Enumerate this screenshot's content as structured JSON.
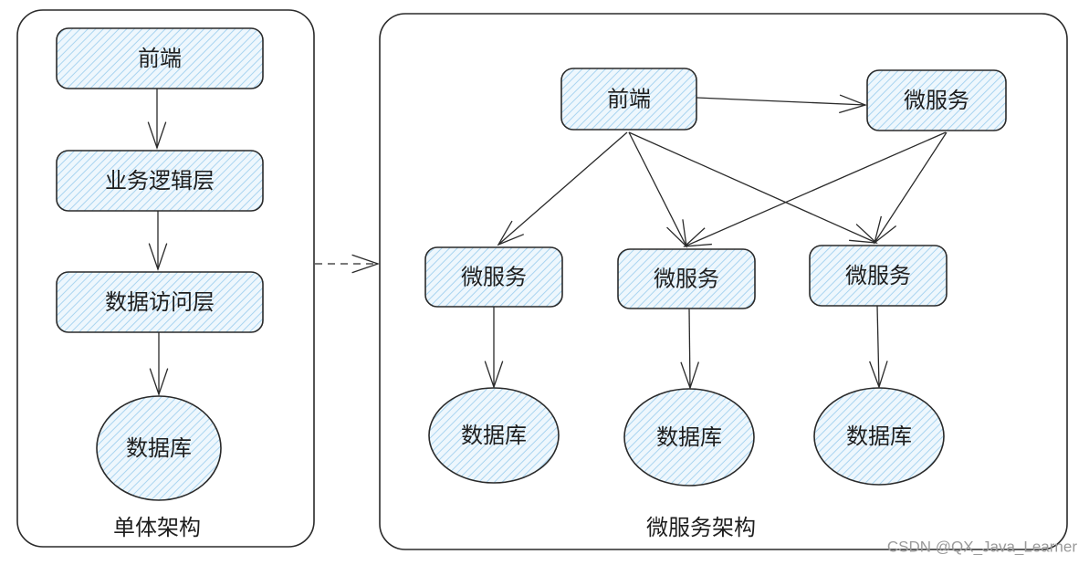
{
  "colors": {
    "node_fill": "#cfe7f7",
    "stroke": "#2a2a2a",
    "text": "#1e1e1e",
    "watermark": "#9a9a9a"
  },
  "monolith": {
    "caption": "单体架构",
    "nodes": [
      {
        "id": "m-frontend",
        "label": "前端",
        "shape": "rect"
      },
      {
        "id": "m-business",
        "label": "业务逻辑层",
        "shape": "rect"
      },
      {
        "id": "m-dataaccess",
        "label": "数据访问层",
        "shape": "rect"
      },
      {
        "id": "m-db",
        "label": "数据库",
        "shape": "ellipse"
      }
    ],
    "edges": [
      {
        "from": "m-frontend",
        "to": "m-business"
      },
      {
        "from": "m-business",
        "to": "m-dataaccess"
      },
      {
        "from": "m-dataaccess",
        "to": "m-db"
      }
    ]
  },
  "transition": {
    "from": "monolith",
    "to": "microservices",
    "style": "dashed"
  },
  "microservices": {
    "caption": "微服务架构",
    "nodes": [
      {
        "id": "s-frontend",
        "label": "前端",
        "shape": "rect"
      },
      {
        "id": "s-ms-top",
        "label": "微服务",
        "shape": "rect"
      },
      {
        "id": "s-ms-1",
        "label": "微服务",
        "shape": "rect"
      },
      {
        "id": "s-ms-2",
        "label": "微服务",
        "shape": "rect"
      },
      {
        "id": "s-ms-3",
        "label": "微服务",
        "shape": "rect"
      },
      {
        "id": "s-db-1",
        "label": "数据库",
        "shape": "ellipse"
      },
      {
        "id": "s-db-2",
        "label": "数据库",
        "shape": "ellipse"
      },
      {
        "id": "s-db-3",
        "label": "数据库",
        "shape": "ellipse"
      }
    ],
    "edges": [
      {
        "from": "s-frontend",
        "to": "s-ms-top"
      },
      {
        "from": "s-frontend",
        "to": "s-ms-1"
      },
      {
        "from": "s-frontend",
        "to": "s-ms-2"
      },
      {
        "from": "s-frontend",
        "to": "s-ms-3"
      },
      {
        "from": "s-ms-top",
        "to": "s-ms-2"
      },
      {
        "from": "s-ms-top",
        "to": "s-ms-3"
      },
      {
        "from": "s-ms-1",
        "to": "s-db-1"
      },
      {
        "from": "s-ms-2",
        "to": "s-db-2"
      },
      {
        "from": "s-ms-3",
        "to": "s-db-3"
      }
    ]
  },
  "watermark": "CSDN @QX_Java_Learner"
}
